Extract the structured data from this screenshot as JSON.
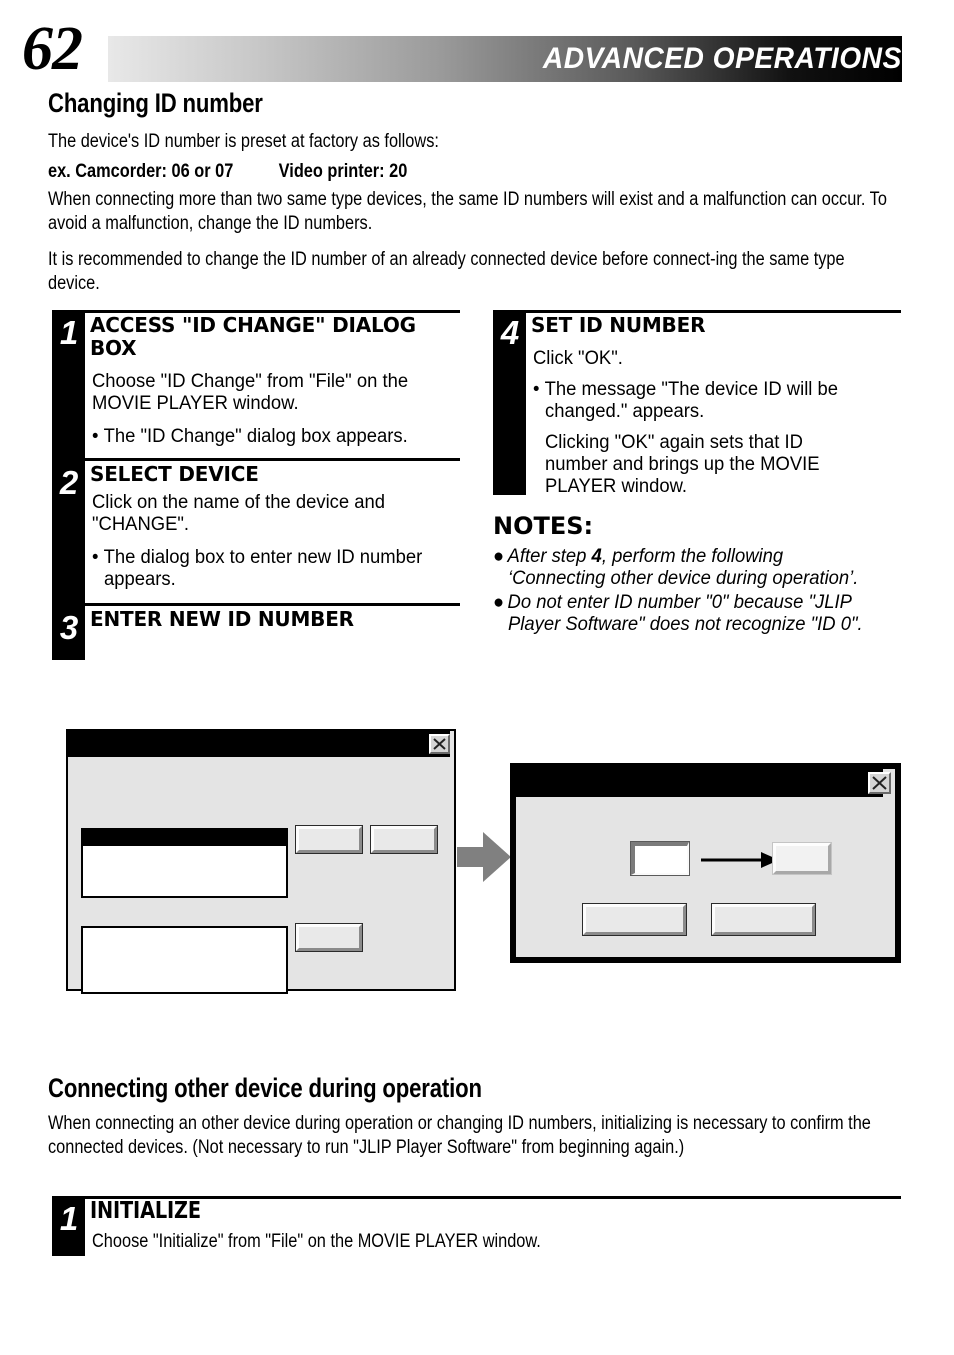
{
  "header": {
    "page_number": "62",
    "title": "ADVANCED OPERATIONS"
  },
  "section1": {
    "heading": "Changing ID number",
    "intro": "The device's ID number is preset at factory as follows:",
    "preset_example": "ex. Camcorder: 06 or 07          Video printer: 20",
    "para1": "When connecting more than two same type devices, the same ID numbers will exist and a malfunction can occur. To avoid a malfunction, change the ID numbers.",
    "para2": "It is recommended to change the ID number of an already connected device before connect-ing the same type device.",
    "steps": [
      {
        "number": "1",
        "title_line1": "ACCESS \"ID CHANGE\" DIALOG",
        "title_line2": "BOX",
        "text_line1": "Choose \"ID Change\" from \"File\" on the",
        "text_line2": "MOVIE PLAYER window.",
        "bullet1": "The \"ID Change\" dialog box appears."
      },
      {
        "number": "2",
        "title_line1": "SELECT DEVICE",
        "text_line1": "Click on the name of the device and",
        "text_line2": "\"CHANGE\".",
        "bullet1_line1": "The dialog box to enter new ID number",
        "bullet1_line2": "appears."
      },
      {
        "number": "3",
        "title_line1": "ENTER NEW ID NUMBER"
      },
      {
        "number": "4",
        "title_line1": "SET ID NUMBER",
        "text_line1": "Click \"OK\".",
        "bullet1_line1": "The message \"The device ID will be",
        "bullet1_line2": "changed.\" appears.",
        "text2_line1": "Clicking \"OK\" again sets that ID",
        "text2_line2": "number and brings up the MOVIE",
        "text2_line3": "PLAYER window."
      }
    ],
    "notes": {
      "heading": "NOTES:",
      "items": [
        {
          "line1_pre": "After step ",
          "line1_bold": "4",
          "line1_post": ", perform the following",
          "line2": "‘Connecting other device during operation’."
        },
        {
          "line1": "Do not enter ID number \"0\" because \"JLIP",
          "line2": "Player Software\" does not recognize \"ID 0\"."
        }
      ]
    }
  },
  "figures": {
    "dialog_left": {
      "name": "id-change-dialog",
      "close_icon": "close-x-icon",
      "list1_label": "",
      "list2_label": "",
      "button1_label": "",
      "button2_label": "",
      "button3_label": ""
    },
    "flow_arrow_icon": "arrow-right-icon",
    "dialog_right": {
      "name": "enter-new-id-dialog",
      "close_icon": "close-x-icon",
      "old_id_value": "",
      "new_id_value": "",
      "inner_arrow_icon": "arrow-right-icon",
      "ok_label": "",
      "cancel_label": ""
    }
  },
  "section2": {
    "heading": "Connecting other device during operation",
    "para1": "When connecting an other device during operation or changing ID numbers, initializing is necessary to confirm the connected devices. (Not necessary to run \"JLIP Player Software\" from beginning again.)",
    "steps": [
      {
        "number": "1",
        "title_line1": "INITIALIZE",
        "text_line1": "Choose \"Initialize\" from \"File\" on the MOVIE PLAYER window."
      }
    ]
  }
}
